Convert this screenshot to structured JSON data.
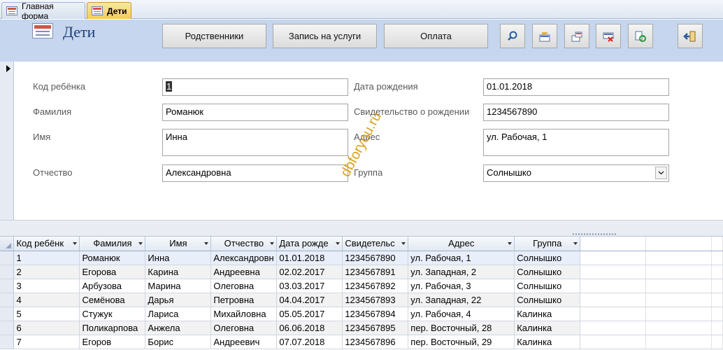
{
  "tabs": [
    {
      "label": "Главная форма",
      "active": false
    },
    {
      "label": "Дети",
      "active": true
    }
  ],
  "header": {
    "title": "Дети",
    "buttons": [
      "Родственники",
      "Запись на услуги",
      "Оплата"
    ],
    "icon_buttons": [
      "search-icon",
      "new-record-icon",
      "copy-record-icon",
      "delete-record-icon",
      "refresh-icon",
      "close-form-icon"
    ]
  },
  "form": {
    "fields": {
      "child_code": {
        "label": "Код ребёнка",
        "value": "1"
      },
      "last_name": {
        "label": "Фамилия",
        "value": "Романюк"
      },
      "first_name": {
        "label": "Имя",
        "value": "Инна"
      },
      "patronymic": {
        "label": "Отчество",
        "value": "Александровна"
      },
      "birth_date": {
        "label": "Дата рождения",
        "value": "01.01.2018"
      },
      "birth_cert": {
        "label": "Свидетельство о рождении",
        "value": "1234567890"
      },
      "address": {
        "label": "Адрес",
        "value": "ул. Рабочая, 1"
      },
      "group": {
        "label": "Группа",
        "value": "Солнышко"
      }
    }
  },
  "watermark": "dbforyou.ru",
  "grid": {
    "columns": [
      "Код ребёнк",
      "Фамилия",
      "Имя",
      "Отчество",
      "Дата рожде",
      "Свидетельс",
      "Адрес",
      "Группа"
    ],
    "rows": [
      [
        "1",
        "Романюк",
        "Инна",
        "Александровн",
        "01.01.2018",
        "1234567890",
        "ул. Рабочая, 1",
        "Солнышко"
      ],
      [
        "2",
        "Егорова",
        "Карина",
        "Андреевна",
        "02.02.2017",
        "1234567891",
        "ул. Западная, 2",
        "Солнышко"
      ],
      [
        "3",
        "Арбузова",
        "Марина",
        "Олеговна",
        "03.03.2017",
        "1234567892",
        "ул. Рабочая, 3",
        "Солнышко"
      ],
      [
        "4",
        "Семёнова",
        "Дарья",
        "Петровна",
        "04.04.2017",
        "1234567893",
        "ул. Западная, 22",
        "Солнышко"
      ],
      [
        "5",
        "Стужук",
        "Лариса",
        "Михайловна",
        "05.05.2017",
        "1234567894",
        "ул. Рабочая, 4",
        "Калинка"
      ],
      [
        "6",
        "Поликарпова",
        "Анжела",
        "Олеговна",
        "06.06.2018",
        "1234567895",
        "пер. Восточный, 28",
        "Калинка"
      ],
      [
        "7",
        "Егоров",
        "Борис",
        "Андреевич",
        "07.07.2018",
        "1234567896",
        "пер. Восточный, 29",
        "Калинка"
      ]
    ]
  },
  "colors": {
    "header_bg": "#c5d6ee",
    "active_tab": "#f7c95c",
    "title": "#1f3d7a",
    "watermark": "#d9a21a"
  }
}
